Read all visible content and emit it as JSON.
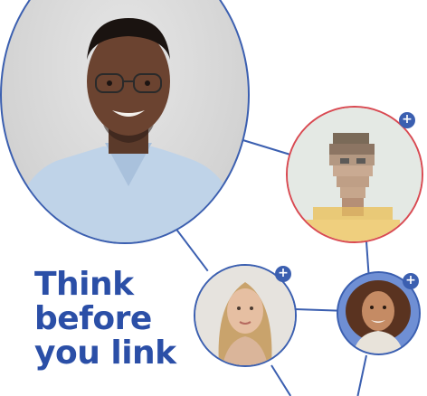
{
  "headline": {
    "line1": "Think",
    "line2": "before",
    "line3": "you link"
  },
  "badges": {
    "plus": "+"
  },
  "colors": {
    "brand_blue": "#2b4fa7",
    "link_blue": "#3b5fb0",
    "alert_red": "#d94a52",
    "background": "#ffffff"
  },
  "icons": {
    "add": "plus-icon",
    "person": "person-icon"
  }
}
